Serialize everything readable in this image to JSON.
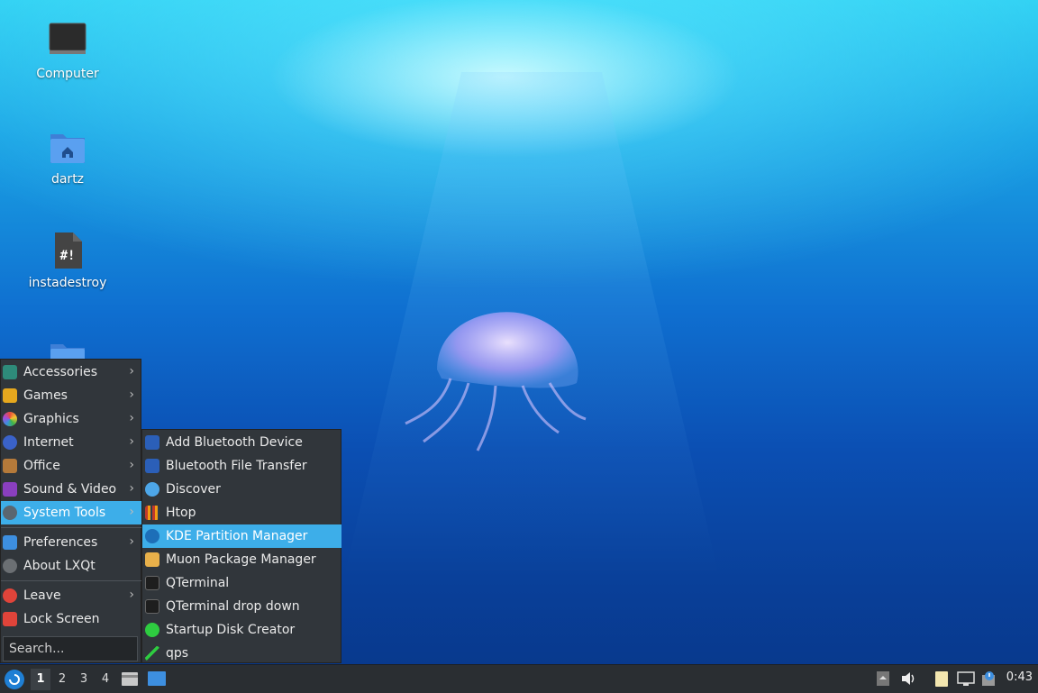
{
  "desktop": {
    "icons": [
      {
        "label": "Computer"
      },
      {
        "label": "dartz"
      },
      {
        "label": "instadestroy"
      }
    ]
  },
  "main_menu": {
    "items": [
      {
        "label": "Accessories"
      },
      {
        "label": "Games"
      },
      {
        "label": "Graphics"
      },
      {
        "label": "Internet"
      },
      {
        "label": "Office"
      },
      {
        "label": "Sound & Video"
      },
      {
        "label": "System Tools"
      },
      {
        "label": "Preferences"
      },
      {
        "label": "About LXQt"
      },
      {
        "label": "Leave"
      },
      {
        "label": "Lock Screen"
      }
    ],
    "submenu_arrow": "›",
    "search_placeholder": "Search..."
  },
  "system_tools_menu": {
    "items": [
      {
        "label": "Add Bluetooth Device"
      },
      {
        "label": "Bluetooth File Transfer"
      },
      {
        "label": "Discover"
      },
      {
        "label": "Htop"
      },
      {
        "label": "KDE Partition Manager"
      },
      {
        "label": "Muon Package Manager"
      },
      {
        "label": "QTerminal"
      },
      {
        "label": "QTerminal drop down"
      },
      {
        "label": "Startup Disk Creator"
      },
      {
        "label": "qps"
      }
    ]
  },
  "taskbar": {
    "desktops": [
      "1",
      "2",
      "3",
      "4"
    ],
    "clock": "0:43"
  },
  "colors": {
    "menu_bg": "#31363b",
    "highlight": "#3daee9",
    "taskbar_bg": "#2a2e32"
  }
}
